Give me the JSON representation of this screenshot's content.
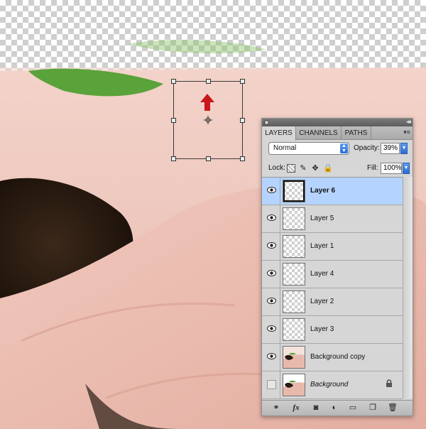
{
  "panel": {
    "tabs": [
      {
        "label": "LAYERS",
        "active": true
      },
      {
        "label": "CHANNELS",
        "active": false
      },
      {
        "label": "PATHS",
        "active": false
      }
    ],
    "blend_mode": "Normal",
    "opacity_label": "Opacity:",
    "opacity_value": "39%",
    "lock_label": "Lock:",
    "fill_label": "Fill:",
    "fill_value": "100%",
    "layers": [
      {
        "name": "Layer 6",
        "visible": true,
        "selected": true,
        "thumbnail": "transparent"
      },
      {
        "name": "Layer 5",
        "visible": true,
        "selected": false,
        "thumbnail": "transparent"
      },
      {
        "name": "Layer 1",
        "visible": true,
        "selected": false,
        "thumbnail": "transparent"
      },
      {
        "name": "Layer 4",
        "visible": true,
        "selected": false,
        "thumbnail": "transparent"
      },
      {
        "name": "Layer 2",
        "visible": true,
        "selected": false,
        "thumbnail": "transparent"
      },
      {
        "name": "Layer 3",
        "visible": true,
        "selected": false,
        "thumbnail": "transparent"
      },
      {
        "name": "Background copy",
        "visible": true,
        "selected": false,
        "thumbnail": "photo"
      },
      {
        "name": "Background",
        "visible": false,
        "selected": false,
        "thumbnail": "photo",
        "locked": true
      }
    ],
    "bottom_icons": [
      "link-icon",
      "fx-icon",
      "layer-mask-icon",
      "adjustment-layer-icon",
      "new-group-icon",
      "new-layer-icon",
      "trash-icon"
    ]
  },
  "colors": {
    "selection_highlight": "#b5d3ff",
    "arrow_red": "#c8161c",
    "panel_bg": "#d6d6d6"
  }
}
